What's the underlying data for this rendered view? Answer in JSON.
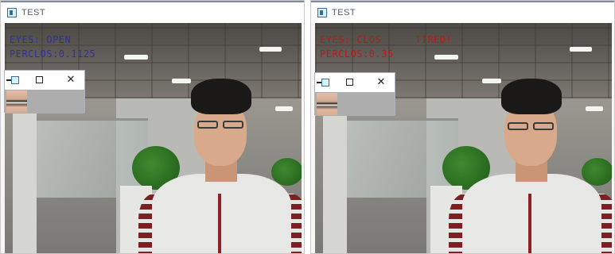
{
  "windows": [
    {
      "title": "TEST",
      "overlay_line1": "EYES: OPEN",
      "overlay_line2": "PERCLOS:0.1125",
      "overlay_extra": "",
      "overlay_color": "#2d2fa8",
      "popup": {
        "min_glyph": "",
        "max_glyph": "",
        "close_glyph": "✕"
      }
    },
    {
      "title": "TEST",
      "overlay_line1": "EYES: CLOS",
      "overlay_line2": "PERCLOS:0.35",
      "overlay_extra": "TIRED!",
      "overlay_color": "#c0161a",
      "popup": {
        "min_glyph": "",
        "max_glyph": "",
        "close_glyph": "✕"
      }
    }
  ],
  "icons": {
    "app": "opencv-window-icon",
    "close": "close-icon",
    "maximize": "maximize-icon",
    "minimize": "minimize-icon"
  }
}
